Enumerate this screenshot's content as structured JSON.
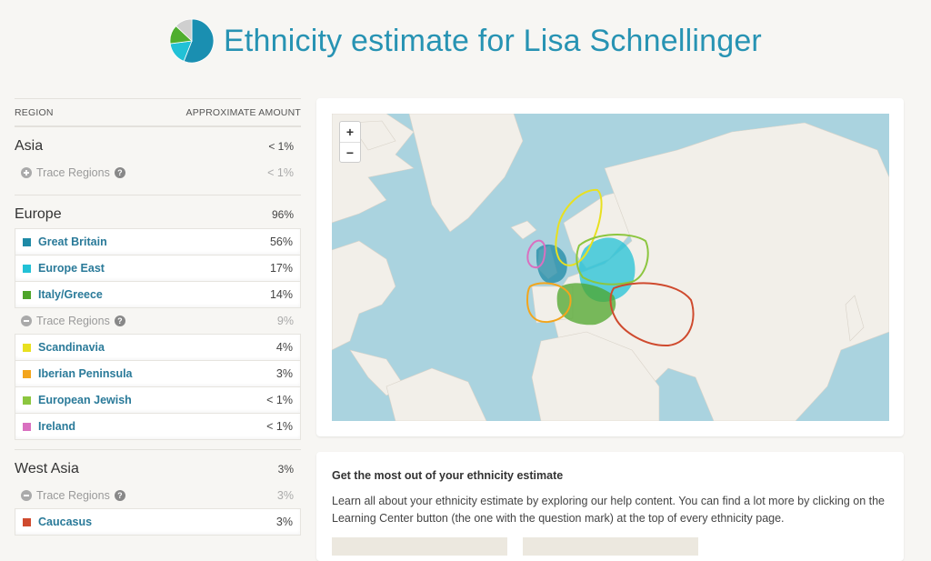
{
  "header": {
    "title": "Ethnicity estimate for Lisa Schnellinger",
    "pie_slices": [
      {
        "region": "Great Britain",
        "percent": 56,
        "color": "#1a8fb1"
      },
      {
        "region": "Europe East",
        "percent": 17,
        "color": "#22c1d6"
      },
      {
        "region": "Italy/Greece",
        "percent": 14,
        "color": "#4fae2e"
      },
      {
        "region": "Other",
        "percent": 13,
        "color": "#cfcfcf"
      }
    ]
  },
  "table": {
    "col_region": "REGION",
    "col_amount": "APPROXIMATE AMOUNT",
    "groups": [
      {
        "name": "Asia",
        "percent": "< 1%",
        "trace": {
          "label": "Trace Regions",
          "percent": "< 1%",
          "expanded": false
        },
        "primary": [],
        "traces": []
      },
      {
        "name": "Europe",
        "percent": "96%",
        "primary": [
          {
            "label": "Great Britain",
            "percent": "56%",
            "color": "#1e8aa6"
          },
          {
            "label": "Europe East",
            "percent": "17%",
            "color": "#22c1d6"
          },
          {
            "label": "Italy/Greece",
            "percent": "14%",
            "color": "#4ea52a"
          }
        ],
        "trace": {
          "label": "Trace Regions",
          "percent": "9%",
          "expanded": true
        },
        "traces": [
          {
            "label": "Scandinavia",
            "percent": "4%",
            "color": "#e8e020"
          },
          {
            "label": "Iberian Peninsula",
            "percent": "3%",
            "color": "#f3a51c"
          },
          {
            "label": "European Jewish",
            "percent": "< 1%",
            "color": "#8cc63f"
          },
          {
            "label": "Ireland",
            "percent": "< 1%",
            "color": "#d970c0"
          }
        ]
      },
      {
        "name": "West Asia",
        "percent": "3%",
        "primary": [],
        "trace": {
          "label": "Trace Regions",
          "percent": "3%",
          "expanded": true
        },
        "traces": [
          {
            "label": "Caucasus",
            "percent": "3%",
            "color": "#cf4a2e"
          }
        ]
      }
    ]
  },
  "map": {
    "zoom_in": "+",
    "zoom_out": "−",
    "regions": [
      {
        "name": "Great Britain",
        "color": "#1e8aa6",
        "style": "filled"
      },
      {
        "name": "Europe East",
        "color": "#22c1d6",
        "style": "filled"
      },
      {
        "name": "Italy/Greece",
        "color": "#4ea52a",
        "style": "filled"
      },
      {
        "name": "Scandinavia",
        "color": "#e8e020",
        "style": "outline"
      },
      {
        "name": "Iberian Peninsula",
        "color": "#f3a51c",
        "style": "outline"
      },
      {
        "name": "European Jewish",
        "color": "#8cc63f",
        "style": "outline"
      },
      {
        "name": "Ireland",
        "color": "#d970c0",
        "style": "outline"
      },
      {
        "name": "Caucasus",
        "color": "#cf4a2e",
        "style": "outline"
      }
    ]
  },
  "info": {
    "title": "Get the most out of your ethnicity estimate",
    "text": "Learn all about your ethnicity estimate by exploring our help content. You can find a lot more by clicking on the Learning Center button (the one with the question mark) at the top of every ethnicity page."
  }
}
